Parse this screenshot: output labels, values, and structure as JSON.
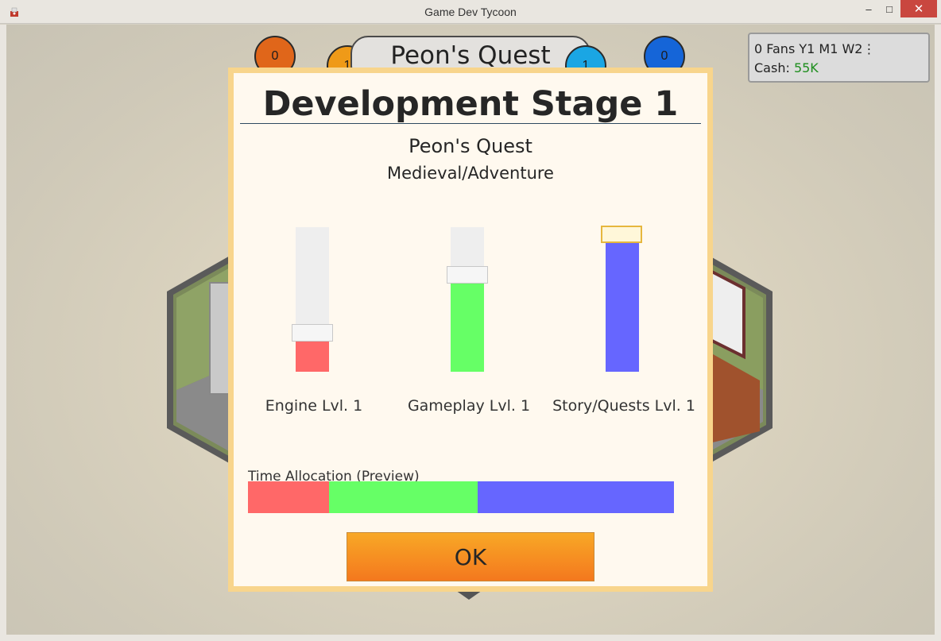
{
  "window": {
    "title": "Game Dev Tycoon",
    "minimize_glyph": "–",
    "maximize_glyph": "□",
    "close_glyph": "✕"
  },
  "hud": {
    "bubbles": [
      {
        "value": "0",
        "color": "#e0661a"
      },
      {
        "value": "1",
        "color": "#ef9a18"
      },
      {
        "value": "1",
        "color": "#1aa6e4"
      },
      {
        "value": "0",
        "color": "#1565d8"
      }
    ],
    "game_title": "Peon's Quest"
  },
  "stats": {
    "line1": "0 Fans Y1 M1 W2",
    "menu_glyph": "⋮",
    "cash_label": "Cash:",
    "cash_value": "55K"
  },
  "dialog": {
    "title": "Development Stage 1",
    "game_name": "Peon's Quest",
    "genre": "Medieval/Adventure",
    "sliders": [
      {
        "label": "Engine Lvl. 1",
        "level": 0.21,
        "color": "#ff6868"
      },
      {
        "label": "Gameplay Lvl. 1",
        "level": 0.61,
        "color": "#66ff66"
      },
      {
        "label": "Story/Quests Lvl. 1",
        "level": 0.89,
        "color": "#6666ff"
      }
    ],
    "allocation_label": "Time Allocation (Preview)",
    "allocation": [
      {
        "name": "Engine",
        "share": 0.19,
        "color": "#ff6868"
      },
      {
        "name": "Gameplay",
        "share": 0.35,
        "color": "#66ff66"
      },
      {
        "name": "Story/Quests",
        "share": 0.46,
        "color": "#6666ff"
      }
    ],
    "ok_label": "OK"
  }
}
